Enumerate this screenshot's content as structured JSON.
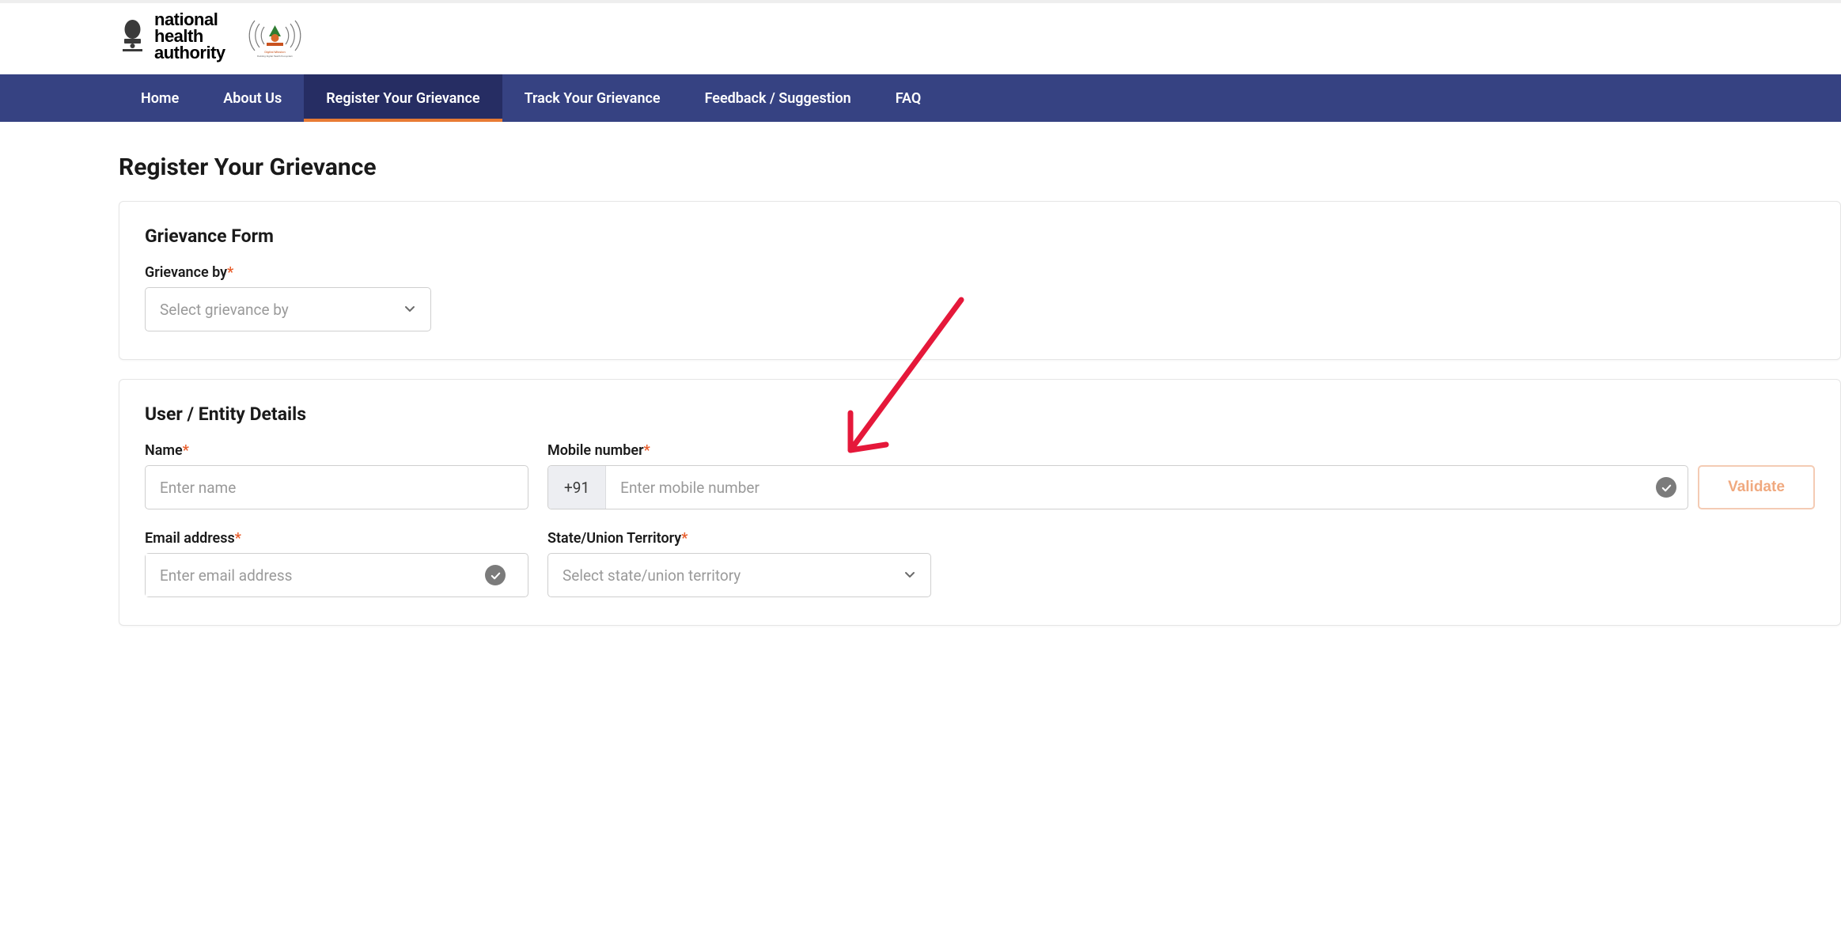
{
  "header": {
    "org_line1": "national",
    "org_line2": "health",
    "org_line3": "authority"
  },
  "nav": {
    "items": [
      {
        "label": "Home",
        "active": false
      },
      {
        "label": "About Us",
        "active": false
      },
      {
        "label": "Register Your Grievance",
        "active": true
      },
      {
        "label": "Track Your Grievance",
        "active": false
      },
      {
        "label": "Feedback / Suggestion",
        "active": false
      },
      {
        "label": "FAQ",
        "active": false
      }
    ]
  },
  "page": {
    "title": "Register Your Grievance"
  },
  "grievance_form": {
    "title": "Grievance Form",
    "grievance_by_label": "Grievance by",
    "grievance_by_placeholder": "Select grievance by"
  },
  "user_details": {
    "title": "User / Entity Details",
    "name_label": "Name",
    "name_placeholder": "Enter name",
    "mobile_label": "Mobile number",
    "mobile_cc": "+91",
    "mobile_placeholder": "Enter mobile number",
    "validate_label": "Validate",
    "email_label": "Email address",
    "email_placeholder": "Enter email address",
    "state_label": "State/Union Territory",
    "state_placeholder": "Select state/union territory"
  }
}
